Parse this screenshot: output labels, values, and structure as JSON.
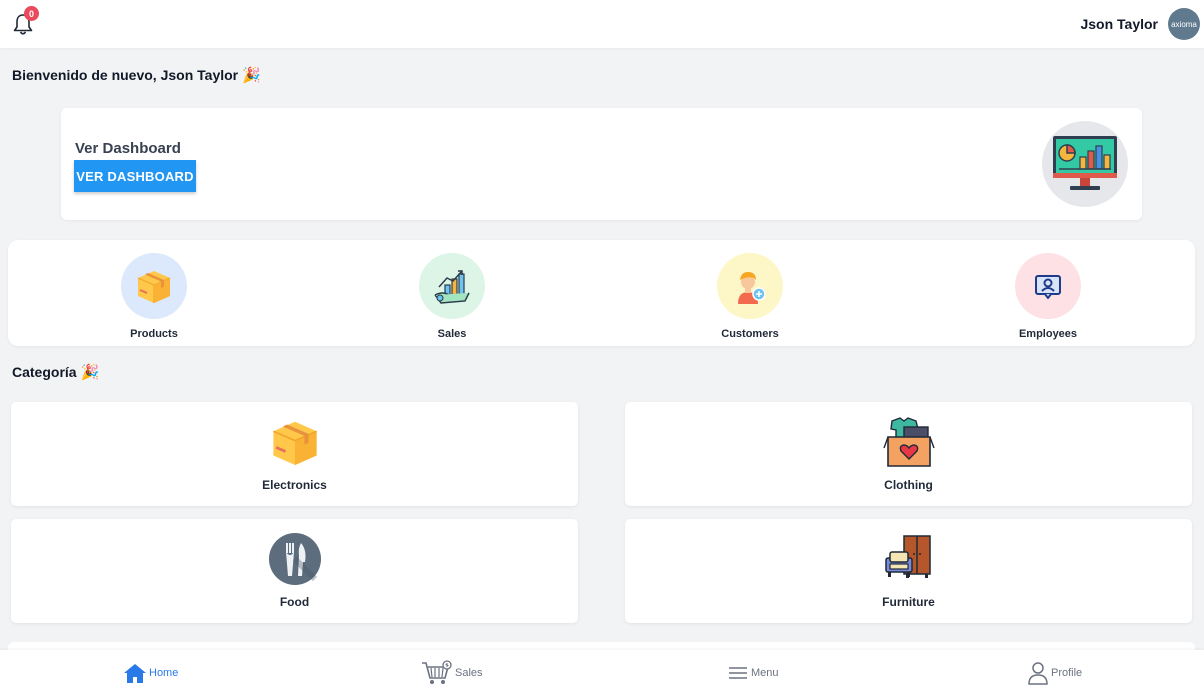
{
  "header": {
    "notification_count": "0",
    "user_name": "Json Taylor",
    "avatar_text": "axioma"
  },
  "welcome": {
    "text": "Bienvenido de nuevo, Json Taylor",
    "emoji": "🎉"
  },
  "dashboard_card": {
    "title": "Ver Dashboard",
    "button_label": "VER DASHBOARD"
  },
  "quick_links": [
    {
      "label": "Products",
      "icon": "box-icon",
      "bg": "#dce8fb"
    },
    {
      "label": "Sales",
      "icon": "sales-growth-icon",
      "bg": "#dcf5e6"
    },
    {
      "label": "Customers",
      "icon": "customer-add-icon",
      "bg": "#fdf6c7"
    },
    {
      "label": "Employees",
      "icon": "employee-badge-icon",
      "bg": "#fde1e4"
    }
  ],
  "categories_section": {
    "title": "Categoría",
    "emoji": "🎉"
  },
  "categories": [
    {
      "label": "Electronics",
      "icon": "box-icon"
    },
    {
      "label": "Clothing",
      "icon": "clothing-box-icon"
    },
    {
      "label": "Food",
      "icon": "cutlery-icon"
    },
    {
      "label": "Furniture",
      "icon": "furniture-icon"
    }
  ],
  "bottom_nav": [
    {
      "label": "Home",
      "icon": "home-icon",
      "active": true
    },
    {
      "label": "Sales",
      "icon": "cart-icon",
      "active": false
    },
    {
      "label": "Menu",
      "icon": "menu-icon",
      "active": false
    },
    {
      "label": "Profile",
      "icon": "user-icon",
      "active": false
    }
  ],
  "colors": {
    "accent": "#2196f3",
    "nav_active": "#2979e8",
    "badge": "#e94b5c"
  }
}
